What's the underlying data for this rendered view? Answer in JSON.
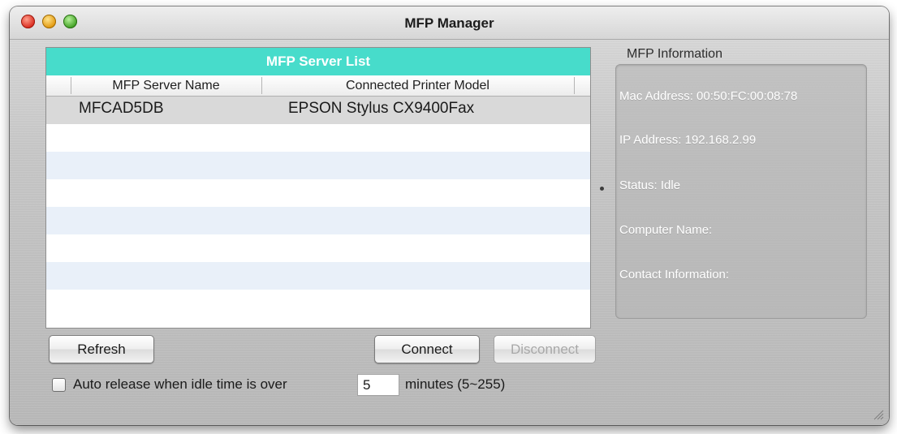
{
  "window": {
    "title": "MFP Manager"
  },
  "server_list": {
    "header": "MFP Server List",
    "columns": [
      "MFP Server Name",
      "Connected Printer Model"
    ],
    "rows": [
      [
        "MFCAD5DB",
        "EPSON Stylus CX9400Fax"
      ]
    ]
  },
  "info": {
    "section_label": "MFP Information",
    "mac_address": "Mac Address: 00:50:FC:00:08:78",
    "ip_address": "IP Address: 192.168.2.99",
    "status": "Status: Idle",
    "computer_name": "Computer Name:",
    "contact": "Contact Information:"
  },
  "buttons": {
    "refresh": "Refresh",
    "connect": "Connect",
    "disconnect": "Disconnect"
  },
  "auto_release": {
    "label": "Auto release when idle time is over",
    "value": "5",
    "suffix": "minutes (5~255)",
    "checked": false
  },
  "colors": {
    "list_header": "#47dccb",
    "alt_row": "#e9f0f9",
    "selected_row": "#d9d9d9"
  }
}
